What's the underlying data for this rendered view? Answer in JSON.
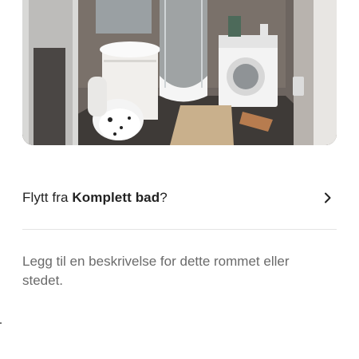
{
  "photo": {
    "alt_name": "bathroom photo"
  },
  "move_row": {
    "prefix": "Flytt fra",
    "room_name": "Komplett bad",
    "suffix": "?",
    "icon": "chevron-right-icon"
  },
  "description": {
    "placeholder": "Legg til en beskrivelse for dette rommet eller stedet."
  },
  "colors": {
    "text_primary": "#222222",
    "text_secondary": "#6a6a6a",
    "divider": "#e3e3e3"
  }
}
